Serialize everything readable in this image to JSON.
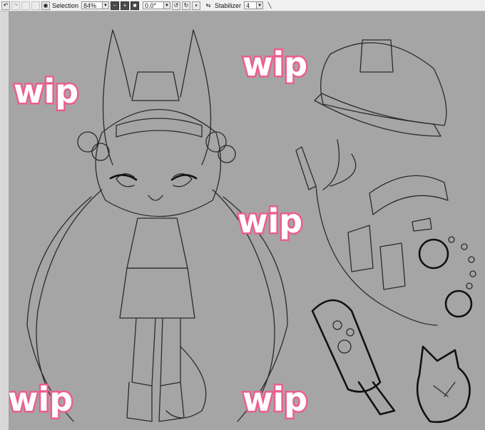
{
  "toolbar": {
    "selection_label": "Selection",
    "zoom_value": "84%",
    "rotation_value": "0.0°",
    "stabilizer_label": "Stabilizer",
    "stabilizer_value": "4"
  },
  "canvas": {
    "watermark_text": "wip",
    "watermark_color": "#ec5d8d",
    "background_color": "#a5a5a5"
  }
}
